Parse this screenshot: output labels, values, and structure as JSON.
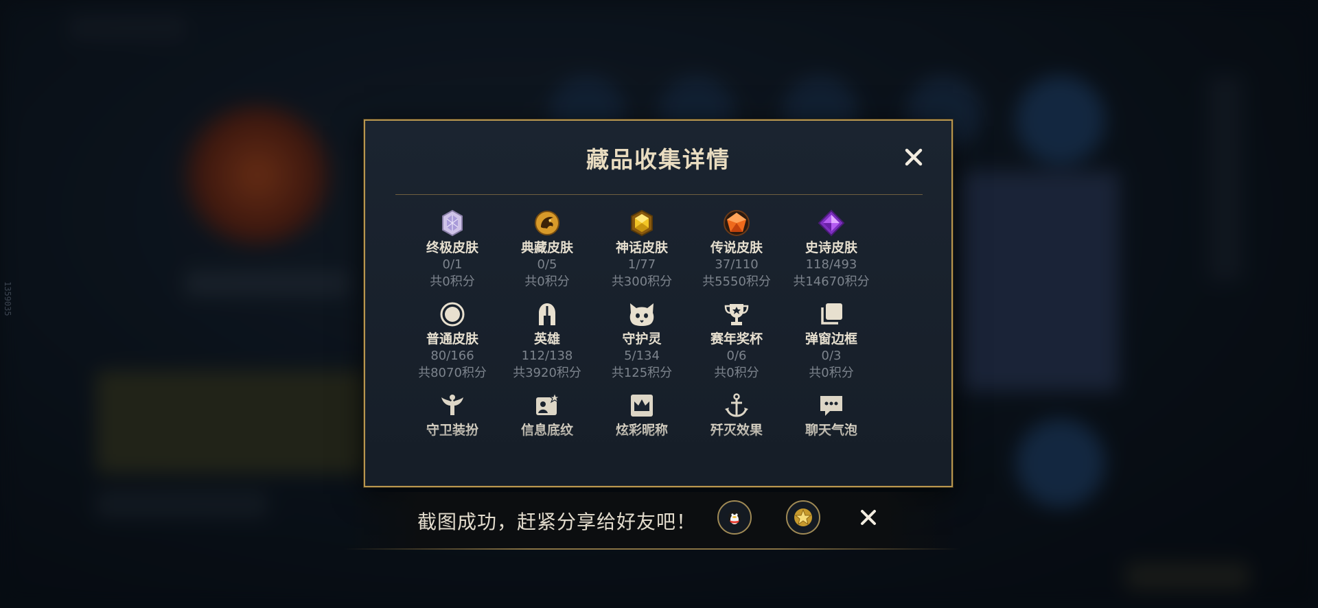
{
  "modal": {
    "title": "藏品收集详情",
    "rows": [
      [
        {
          "icon": "ultimate-skin-gem-icon",
          "name": "终极皮肤",
          "count": "0/1",
          "points": "共0积分"
        },
        {
          "icon": "collection-skin-gem-icon",
          "name": "典藏皮肤",
          "count": "0/5",
          "points": "共0积分"
        },
        {
          "icon": "mythic-skin-gem-icon",
          "name": "神话皮肤",
          "count": "1/77",
          "points": "共300积分"
        },
        {
          "icon": "legendary-skin-gem-icon",
          "name": "传说皮肤",
          "count": "37/110",
          "points": "共5550积分"
        },
        {
          "icon": "epic-skin-gem-icon",
          "name": "史诗皮肤",
          "count": "118/493",
          "points": "共14670积分"
        }
      ],
      [
        {
          "icon": "normal-skin-circle-icon",
          "name": "普通皮肤",
          "count": "80/166",
          "points": "共8070积分"
        },
        {
          "icon": "hero-helmet-icon",
          "name": "英雄",
          "count": "112/138",
          "points": "共3920积分"
        },
        {
          "icon": "guardian-spirit-cat-icon",
          "name": "守护灵",
          "count": "5/134",
          "points": "共125积分"
        },
        {
          "icon": "season-trophy-icon",
          "name": "赛年奖杯",
          "count": "0/6",
          "points": "共0积分"
        },
        {
          "icon": "popup-frame-icon",
          "name": "弹窗边框",
          "count": "0/3",
          "points": "共0积分"
        }
      ],
      [
        {
          "icon": "guard-outfit-icon",
          "name": "守卫装扮"
        },
        {
          "icon": "info-background-icon",
          "name": "信息底纹"
        },
        {
          "icon": "colorful-nickname-crown-icon",
          "name": "炫彩昵称"
        },
        {
          "icon": "kill-effect-anchor-icon",
          "name": "歼灭效果"
        },
        {
          "icon": "chat-bubble-icon",
          "name": "聊天气泡"
        }
      ]
    ]
  },
  "toast": {
    "message": "截图成功，赶紧分享给好友吧！",
    "share_buttons": [
      {
        "icon": "qq-penguin-icon"
      },
      {
        "icon": "star-badge-icon"
      }
    ]
  },
  "side_id": "1359035",
  "colors": {
    "gold_border": "#b8964f",
    "title_text": "#e9dcc0",
    "muted_text": "#7d848d",
    "modal_bg": "#1b2430"
  }
}
